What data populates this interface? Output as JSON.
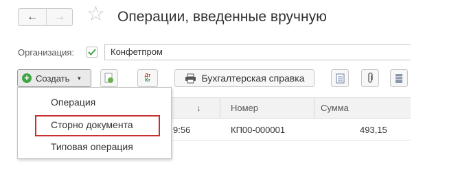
{
  "header": {
    "title": "Операции, введенные вручную",
    "nav_back_icon": "arrow-left-icon",
    "nav_forward_icon": "arrow-right-icon",
    "favorite_icon": "star-icon"
  },
  "filter": {
    "organization_label": "Организация:",
    "organization_checked": true,
    "organization_value": "Конфетпром"
  },
  "toolbar": {
    "create_label": "Создать",
    "report_label": "Бухгалтерская справка",
    "dtkt_top": "Дт",
    "dtkt_bottom": "Кт"
  },
  "table": {
    "columns": [
      "↓",
      "Номер",
      "Сумма"
    ],
    "rows": [
      {
        "date_fragment": "9:56",
        "number": "КП00-000001",
        "amount": "493,15"
      }
    ]
  },
  "create_menu": {
    "items": [
      {
        "label": "Операция",
        "highlighted": false
      },
      {
        "label": "Сторно документа",
        "highlighted": true
      },
      {
        "label": "Типовая операция",
        "highlighted": false
      }
    ]
  },
  "colors": {
    "accent_green": "#41a548",
    "highlight_red": "#c82f2f"
  }
}
